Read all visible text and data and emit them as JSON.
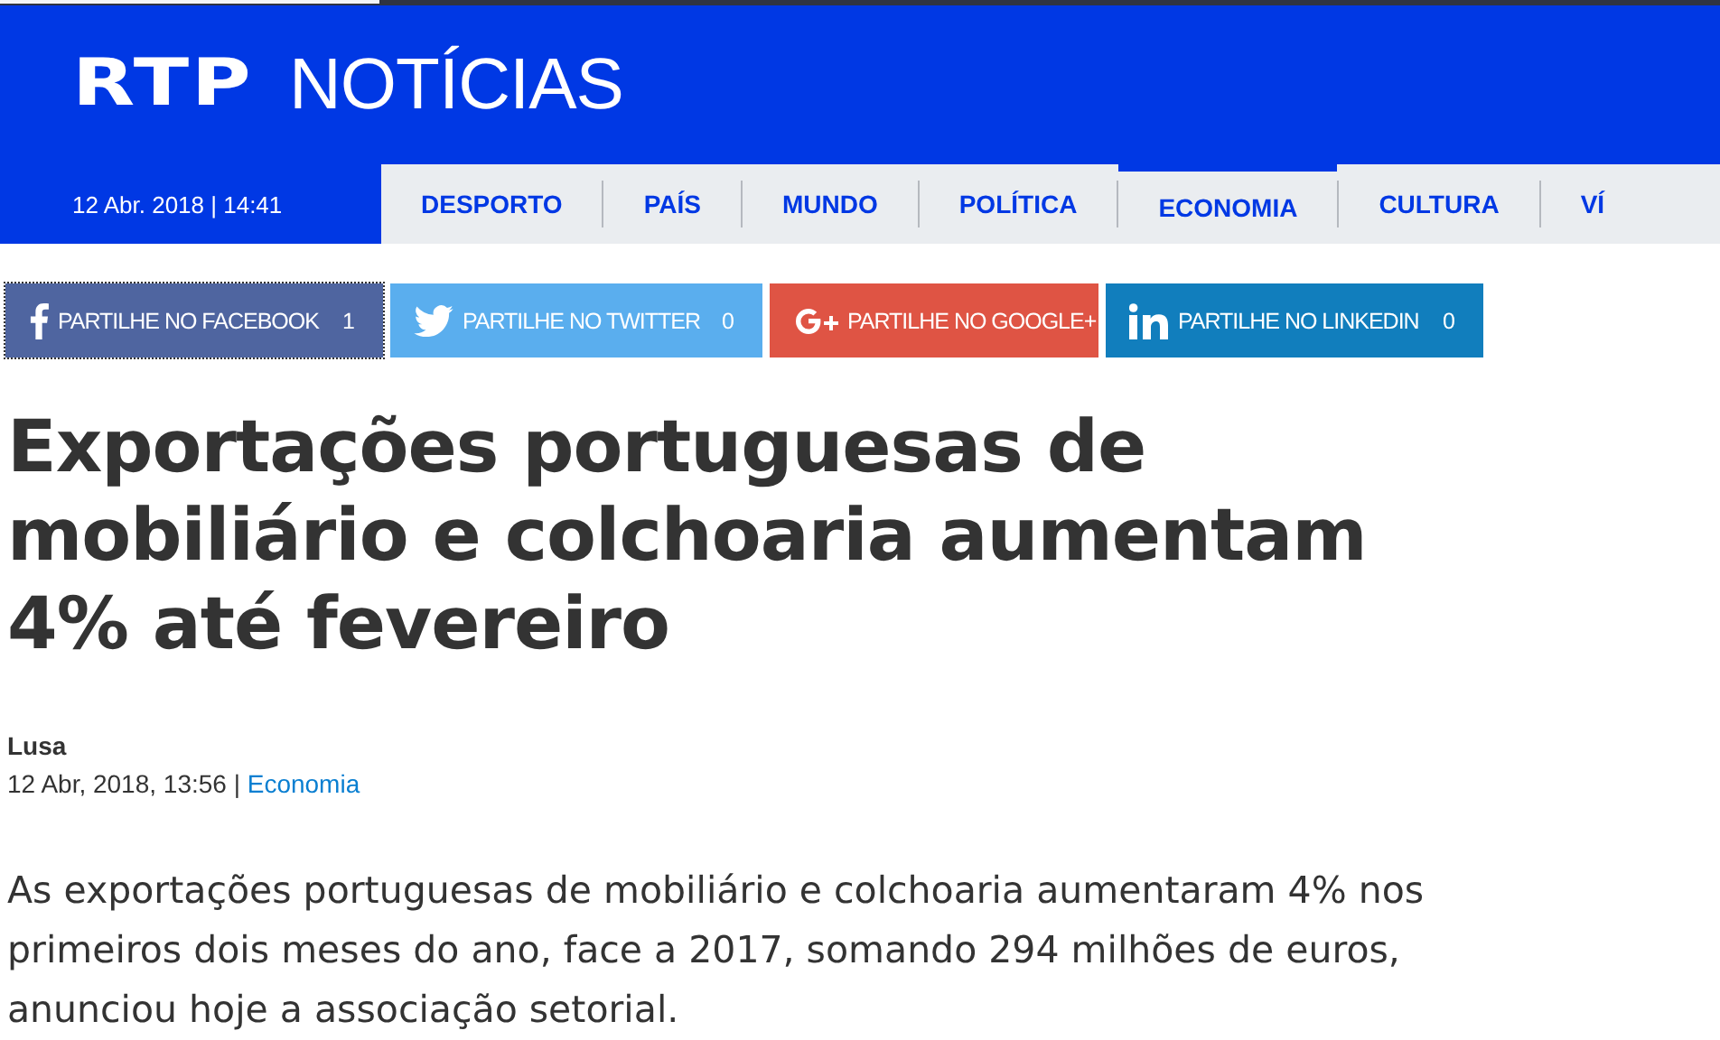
{
  "header": {
    "logo_mark": "RTP",
    "logo_text": "NOTÍCIAS",
    "datetime": "12 Abr. 2018 | 14:41"
  },
  "nav": [
    {
      "label": "DESPORTO",
      "selected": false
    },
    {
      "label": "PAÍS",
      "selected": false
    },
    {
      "label": "MUNDO",
      "selected": false
    },
    {
      "label": "POLÍTICA",
      "selected": false
    },
    {
      "label": "ECONOMIA",
      "selected": true
    },
    {
      "label": "CULTURA",
      "selected": false
    },
    {
      "label": "VÍ",
      "selected": false
    }
  ],
  "share": [
    {
      "kind": "facebook",
      "label": "PARTILHE NO FACEBOOK",
      "count": "1"
    },
    {
      "kind": "twitter",
      "label": "PARTILHE NO TWITTER",
      "count": "0"
    },
    {
      "kind": "google",
      "label": "PARTILHE NO GOOGLE+"
    },
    {
      "kind": "linkedin",
      "label": "PARTILHE NO LINKEDIN",
      "count": "0"
    }
  ],
  "article": {
    "title": "Exportações portuguesas de mobiliário e colchoaria aumentam 4% até fevereiro",
    "author": "Lusa",
    "date": "12 Abr, 2018, 13:56 |",
    "category": "Economia",
    "lead": "As exportações portuguesas de mobiliário e colchoaria aumentaram 4% nos primeiros dois meses do ano, face a 2017, somando 294 milhões de euros, anunciou hoje a associação setorial."
  }
}
